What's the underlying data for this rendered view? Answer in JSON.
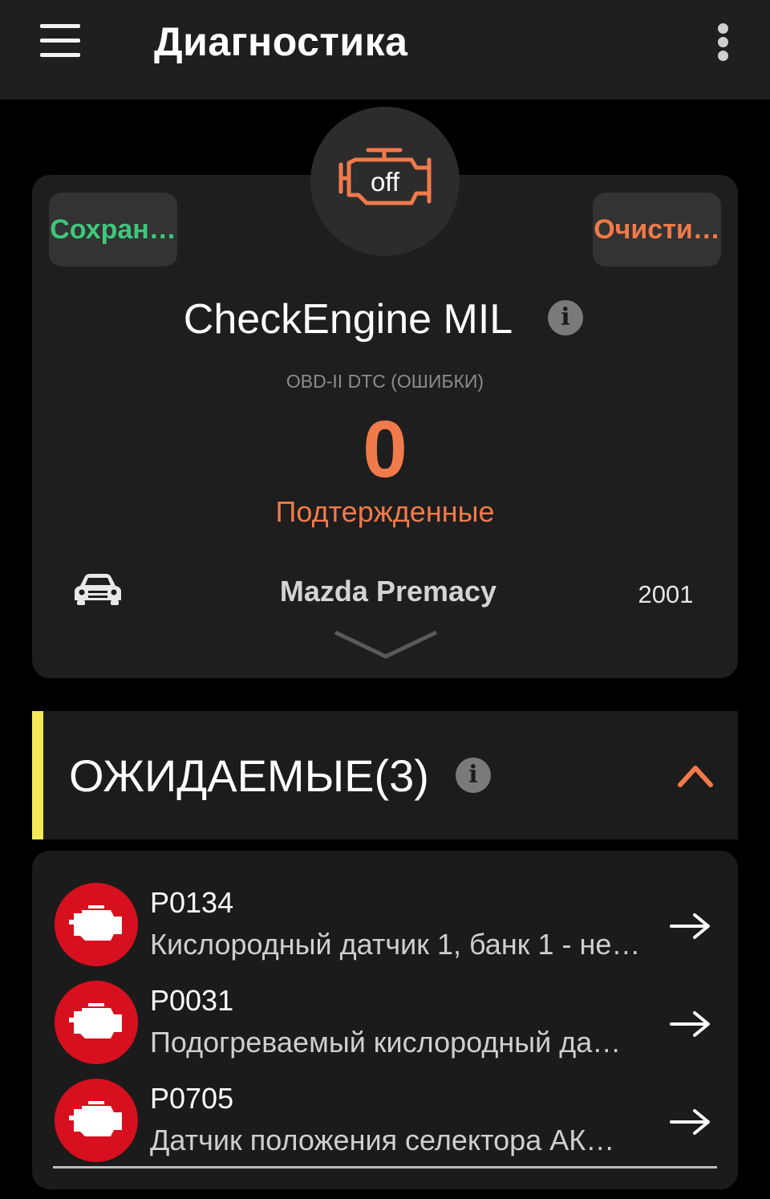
{
  "appbar": {
    "title": "Диагностика",
    "menu_icon": "hamburger-menu-icon",
    "more_icon": "more-vert-icon"
  },
  "status_card": {
    "mil_icon": "check-engine-icon",
    "mil_state": "off",
    "save_label": "Сохран…",
    "clear_label": "Очисти…",
    "title": "CheckEngine MIL",
    "dtc_label": "OBD-II DTC (ОШИБКИ)",
    "dtc_count": "0",
    "dtc_status": "Подтержденные",
    "vehicle_icon": "car-icon",
    "vehicle_name": "Mazda Premacy",
    "vehicle_year": "2001"
  },
  "pending": {
    "title": "ОЖИДАЕМЫЕ(3)",
    "items": [
      {
        "code": "P0134",
        "description": "Кислородный датчик 1, банк 1 - не…"
      },
      {
        "code": "P0031",
        "description": "Подогреваемый кислородный да…"
      },
      {
        "code": "P0705",
        "description": "Датчик положения селектора АК…"
      }
    ]
  },
  "colors": {
    "background": "#000000",
    "appbar": "#1f1f1f",
    "card": "#1e1e1e",
    "accent_orange": "#f07a4a",
    "accent_green": "#3ec77a",
    "section_accent_yellow": "#f3e85a",
    "dtc_badge_red": "#d6101e"
  }
}
